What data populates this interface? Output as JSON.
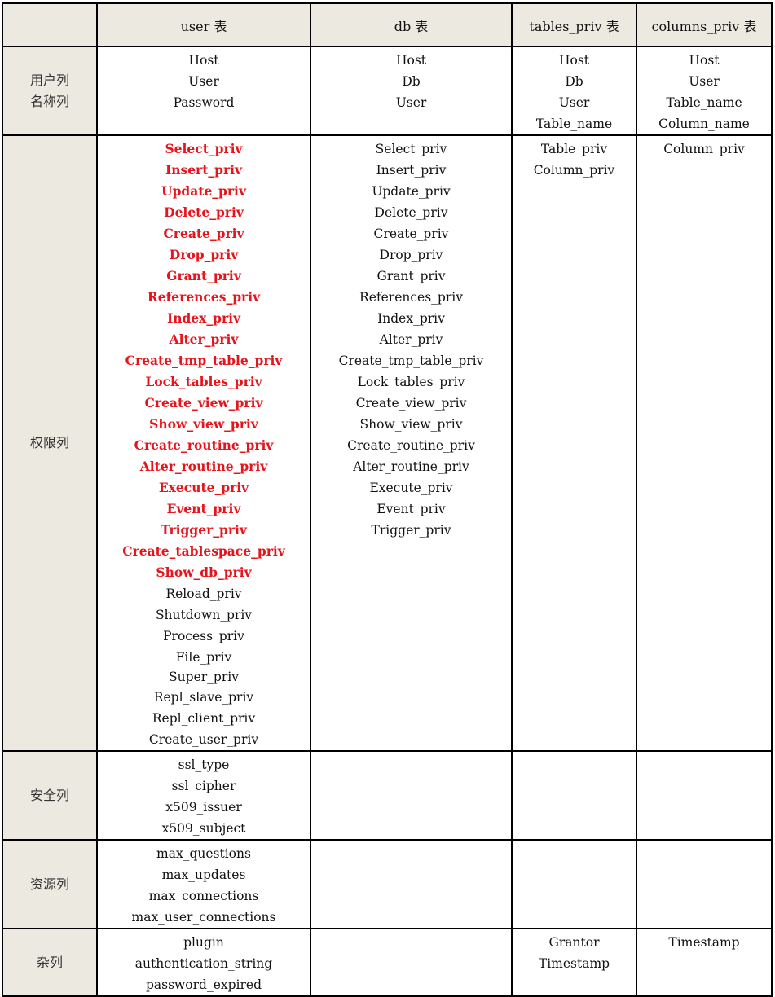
{
  "headers": [
    "",
    "user 表",
    "db 表",
    "tables_priv 表",
    "columns_priv 表"
  ],
  "rows": [
    {
      "label": [
        "用户列",
        "名称列"
      ],
      "user": [
        {
          "t": "Host"
        },
        {
          "t": "User"
        },
        {
          "t": "Password"
        }
      ],
      "db": [
        {
          "t": "Host"
        },
        {
          "t": "Db"
        },
        {
          "t": "User"
        }
      ],
      "tables_priv": [
        {
          "t": "Host"
        },
        {
          "t": "Db"
        },
        {
          "t": "User"
        },
        {
          "t": "Table_name"
        }
      ],
      "columns_priv": [
        {
          "t": "Host"
        },
        {
          "t": "User"
        },
        {
          "t": "Table_name"
        },
        {
          "t": "Column_name"
        }
      ]
    },
    {
      "label": [
        "权限列"
      ],
      "user": [
        {
          "t": "Select_priv",
          "hl": true
        },
        {
          "t": "Insert_priv",
          "hl": true
        },
        {
          "t": "Update_priv",
          "hl": true
        },
        {
          "t": "Delete_priv",
          "hl": true
        },
        {
          "t": "Create_priv",
          "hl": true
        },
        {
          "t": "Drop_priv",
          "hl": true
        },
        {
          "t": "Grant_priv",
          "hl": true
        },
        {
          "t": "References_priv",
          "hl": true
        },
        {
          "t": "Index_priv",
          "hl": true
        },
        {
          "t": "Alter_priv",
          "hl": true
        },
        {
          "t": "Create_tmp_table_priv",
          "hl": true
        },
        {
          "t": "Lock_tables_priv",
          "hl": true
        },
        {
          "t": "Create_view_priv",
          "hl": true
        },
        {
          "t": "Show_view_priv",
          "hl": true
        },
        {
          "t": "Create_routine_priv",
          "hl": true
        },
        {
          "t": "Alter_routine_priv",
          "hl": true
        },
        {
          "t": "Execute_priv",
          "hl": true
        },
        {
          "t": "Event_priv",
          "hl": true
        },
        {
          "t": "Trigger_priv",
          "hl": true
        },
        {
          "t": "Create_tablespace_priv",
          "hl": true
        },
        {
          "t": "Show_db_priv",
          "hl": true
        },
        {
          "t": "Reload_priv"
        },
        {
          "t": "Shutdown_priv"
        },
        {
          "t": "Process_priv"
        },
        {
          "t": "File_priv"
        },
        {
          "t": "Super_priv",
          "tight": true
        },
        {
          "t": "Repl_slave_priv"
        },
        {
          "t": "Repl_client_priv"
        },
        {
          "t": "Create_user_priv"
        }
      ],
      "db": [
        {
          "t": "Select_priv"
        },
        {
          "t": "Insert_priv"
        },
        {
          "t": "Update_priv"
        },
        {
          "t": "Delete_priv"
        },
        {
          "t": "Create_priv"
        },
        {
          "t": "Drop_priv"
        },
        {
          "t": "Grant_priv"
        },
        {
          "t": "References_priv"
        },
        {
          "t": "Index_priv"
        },
        {
          "t": "Alter_priv"
        },
        {
          "t": "Create_tmp_table_priv"
        },
        {
          "t": "Lock_tables_priv"
        },
        {
          "t": "Create_view_priv"
        },
        {
          "t": "Show_view_priv"
        },
        {
          "t": "Create_routine_priv"
        },
        {
          "t": "Alter_routine_priv"
        },
        {
          "t": "Execute_priv"
        },
        {
          "t": "Event_priv"
        },
        {
          "t": "Trigger_priv"
        }
      ],
      "tables_priv": [
        {
          "t": "Table_priv"
        },
        {
          "t": "Column_priv"
        }
      ],
      "columns_priv": [
        {
          "t": "Column_priv"
        }
      ]
    },
    {
      "label": [
        "安全列"
      ],
      "user": [
        {
          "t": "ssl_type"
        },
        {
          "t": "ssl_cipher"
        },
        {
          "t": "x509_issuer"
        },
        {
          "t": "x509_subject"
        }
      ],
      "db": [],
      "tables_priv": [],
      "columns_priv": []
    },
    {
      "label": [
        "资源列"
      ],
      "user": [
        {
          "t": "max_questions"
        },
        {
          "t": "max_updates"
        },
        {
          "t": "max_connections"
        },
        {
          "t": "max_user_connections"
        }
      ],
      "db": [],
      "tables_priv": [],
      "columns_priv": []
    },
    {
      "label": [
        "杂列"
      ],
      "user": [
        {
          "t": "plugin"
        },
        {
          "t": "authentication_string"
        },
        {
          "t": "password_expired"
        }
      ],
      "db": [],
      "tables_priv": [
        {
          "t": "Grantor"
        },
        {
          "t": "Timestamp"
        }
      ],
      "columns_priv": [
        {
          "t": "Timestamp"
        }
      ]
    }
  ],
  "colors": {
    "header_bg": "#ECE9E0",
    "highlight": "#E8141C",
    "border": "#000000"
  }
}
